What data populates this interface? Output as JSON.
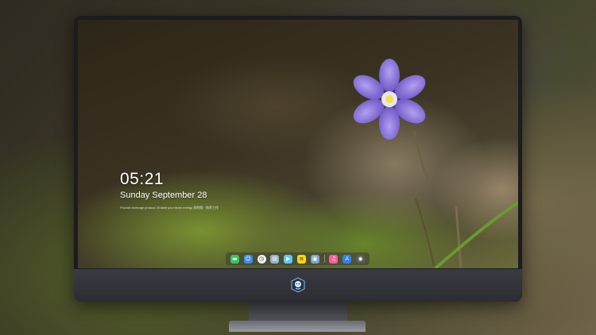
{
  "lockscreen": {
    "time": "05:21",
    "date": "Sunday September  28",
    "tagline": "Provide leverage product; Enable your team energy 即時版 · 效率工作"
  },
  "dock": {
    "apps": [
      {
        "name": "messages",
        "glyph": "▬",
        "color": "#34c759"
      },
      {
        "name": "finder",
        "glyph": "☺",
        "color": "#3a8ee6"
      },
      {
        "name": "clock",
        "glyph": "◷",
        "color": "#f2f2f2"
      },
      {
        "name": "notes-folder",
        "glyph": "▤",
        "color": "#9ab0c8"
      },
      {
        "name": "video",
        "glyph": "▶",
        "color": "#5ac8fa"
      },
      {
        "name": "notes",
        "glyph": "≡",
        "color": "#ffd60a"
      },
      {
        "name": "preview",
        "glyph": "▣",
        "color": "#7aa6c2"
      },
      {
        "name": "music",
        "glyph": "♫",
        "color": "#ff5aa5"
      },
      {
        "name": "app-store",
        "glyph": "A",
        "color": "#2f7ef6"
      },
      {
        "name": "camera",
        "glyph": "◉",
        "color": "#5a5a5a"
      }
    ]
  },
  "colors": {
    "bezel": "#1c1c20",
    "petal": "#8a72d8",
    "petal_center": "#f2e24a"
  }
}
